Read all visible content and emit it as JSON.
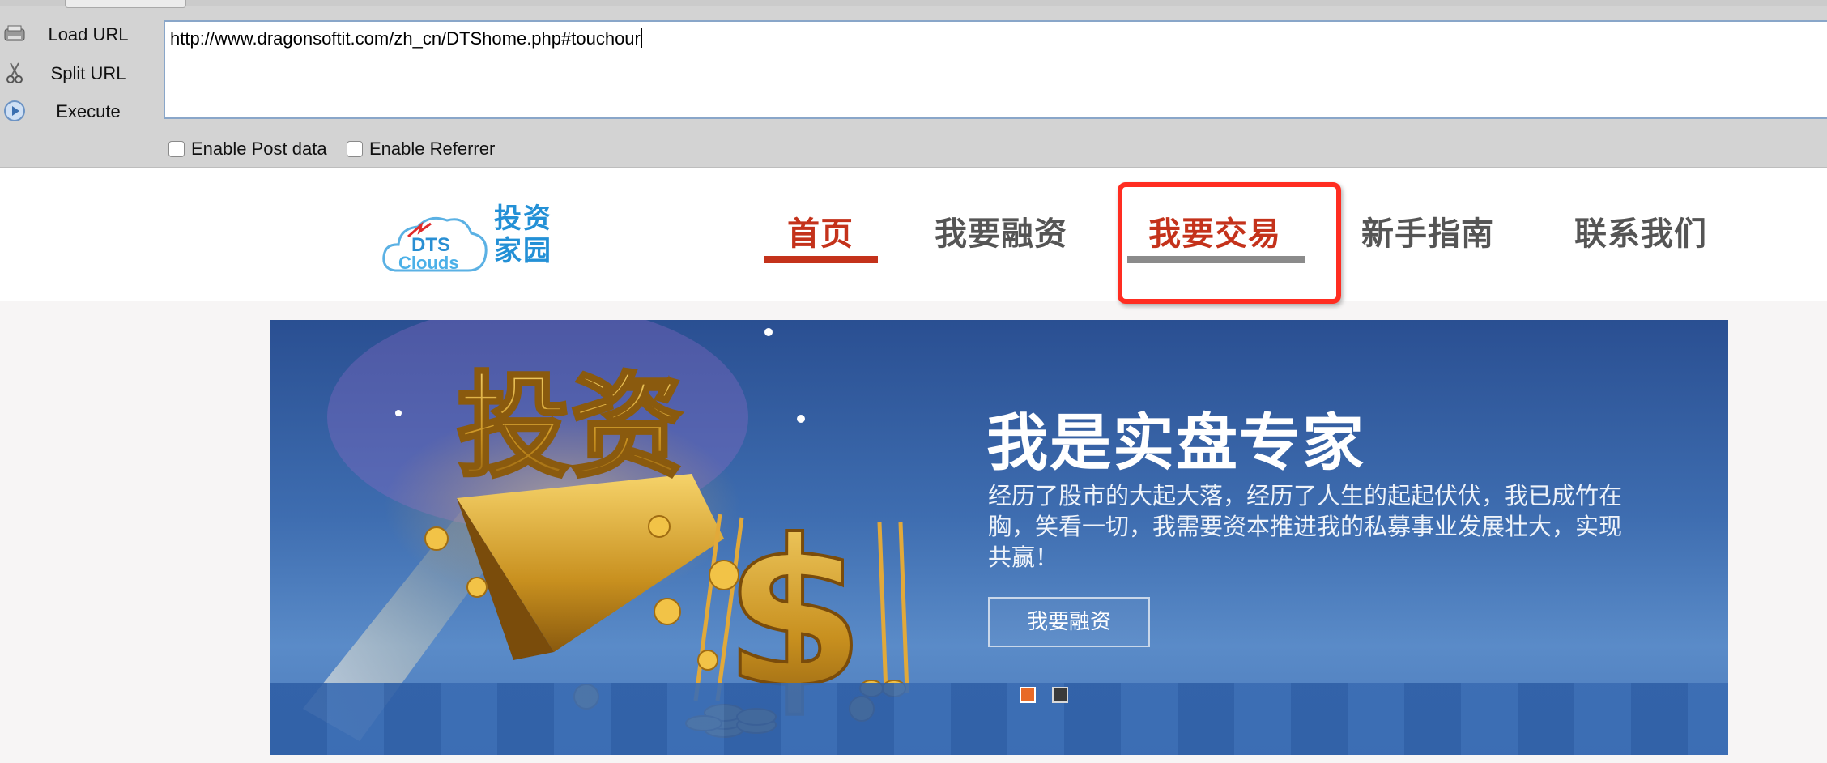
{
  "hackbar": {
    "actions": [
      {
        "label": "Load URL",
        "icon": "load-url-icon"
      },
      {
        "label": "Split URL",
        "icon": "scissors-icon"
      },
      {
        "label": "Execute",
        "icon": "play-icon"
      }
    ],
    "url_value": "http://www.dragonsoftit.com/zh_cn/DTShome.php#touchour",
    "enable_post_label": "Enable Post data",
    "enable_referrer_label": "Enable Referrer"
  },
  "site": {
    "logo": {
      "text_top": "投资",
      "text_bottom": "家园",
      "brand_top": "DTS",
      "brand_bottom": "Clouds"
    },
    "nav": [
      {
        "label": "首页",
        "active": true
      },
      {
        "label": "我要融资",
        "active": false
      },
      {
        "label": "我要交易",
        "active": false
      },
      {
        "label": "新手指南",
        "active": false
      },
      {
        "label": "联系我们",
        "active": false
      }
    ],
    "colors": {
      "active": "#c4321b",
      "highlight": "#ff2d21",
      "logo": "#2390d6"
    }
  },
  "banner": {
    "art_text": "投资",
    "title": "我是实盘专家",
    "description": "经历了股市的大起大落，经历了人生的起起伏伏，我已成竹在胸，笑看一切，我需要资本推进我的私募事业发展壮大，实现共赢！",
    "button_label": "我要融资"
  }
}
